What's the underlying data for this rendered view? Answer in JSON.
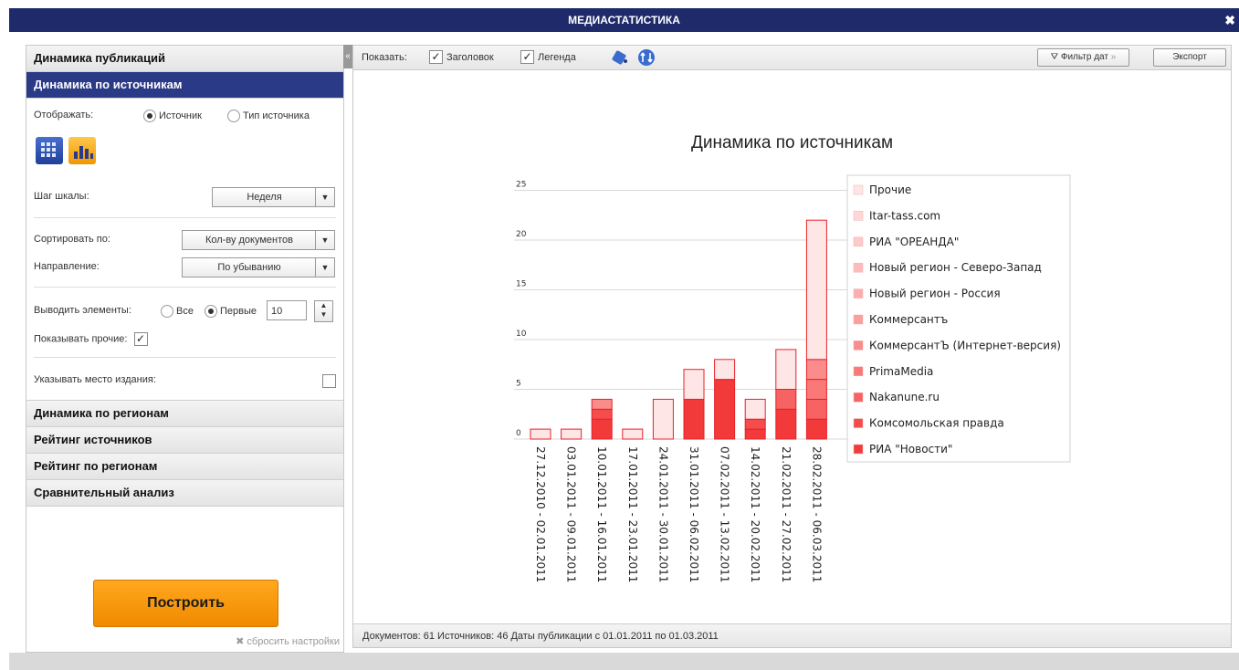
{
  "window": {
    "title": "МЕДИАСТАТИСТИКА",
    "close_glyph": "✖"
  },
  "left": {
    "section_publications": "Динамика публикаций",
    "section_sources": "Динамика по источникам",
    "display_label": "Отображать:",
    "radio_source": "Источник",
    "radio_source_type": "Тип источника",
    "scale_step_label": "Шаг шкалы:",
    "scale_step_value": "Неделя",
    "sort_label": "Сортировать по:",
    "sort_value": "Кол-ву документов",
    "direction_label": "Направление:",
    "direction_value": "По убыванию",
    "output_label": "Выводить элементы:",
    "radio_all": "Все",
    "radio_first": "Первые",
    "first_count": "10",
    "show_other_label": "Показывать прочие:",
    "place_label": "Указывать место издания:",
    "section_regions": "Динамика по регионам",
    "section_rating_sources": "Рейтинг источников",
    "section_rating_regions": "Рейтинг по регионам",
    "section_compare": "Сравнительный анализ",
    "build_button": "Построить",
    "reset_link": "сбросить настройки"
  },
  "toolbar": {
    "show_label": "Показать:",
    "header_check": "Заголовок",
    "legend_check": "Легенда",
    "date_filter": "Фильтр дат",
    "export": "Экспорт"
  },
  "status": {
    "text": "Документов: 61  Источников: 46  Даты публикации с 01.01.2011 по 01.03.2011"
  },
  "chart_data": {
    "type": "bar",
    "stacked": true,
    "title": "Динамика по источникам",
    "ylim": [
      0,
      25
    ],
    "yticks": [
      "0",
      "5",
      "10",
      "15",
      "20",
      "25"
    ],
    "categories": [
      "27.12.2010 - 02.01.2011",
      "03.01.2011 - 09.01.2011",
      "10.01.2011 - 16.01.2011",
      "17.01.2011 - 23.01.2011",
      "24.01.2011 - 30.01.2011",
      "31.01.2011 - 06.02.2011",
      "07.02.2011 - 13.02.2011",
      "14.02.2011 - 20.02.2011",
      "21.02.2011 - 27.02.2011",
      "28.02.2011 - 06.03.2011"
    ],
    "series": [
      {
        "name": "РИА \"Новости\"",
        "color": "#f23a3a",
        "values": [
          0,
          0,
          2,
          0,
          0,
          4,
          6,
          1,
          3,
          2
        ]
      },
      {
        "name": "Комсомольская правда",
        "color": "#f54c4c",
        "values": [
          0,
          0,
          1,
          0,
          0,
          0,
          0,
          1,
          0,
          0
        ]
      },
      {
        "name": "Nakanune.ru",
        "color": "#f76262",
        "values": [
          0,
          0,
          0,
          0,
          0,
          0,
          0,
          0,
          2,
          2
        ]
      },
      {
        "name": "PrimaMedia",
        "color": "#f97878",
        "values": [
          0,
          0,
          0,
          0,
          0,
          0,
          0,
          0,
          0,
          2
        ]
      },
      {
        "name": "КоммерсантЪ (Интернет-версия)",
        "color": "#fa8c8c",
        "values": [
          0,
          0,
          1,
          0,
          0,
          0,
          0,
          0,
          0,
          2
        ]
      },
      {
        "name": "Коммерсантъ",
        "color": "#fb9e9e",
        "values": [
          0,
          0,
          0,
          0,
          0,
          0,
          0,
          0,
          0,
          0
        ]
      },
      {
        "name": "Новый регион - Россия",
        "color": "#fcaeae",
        "values": [
          0,
          0,
          0,
          0,
          0,
          0,
          0,
          0,
          0,
          0
        ]
      },
      {
        "name": "Новый регион - Северо-Запад",
        "color": "#fdbcbc",
        "values": [
          0,
          0,
          0,
          0,
          0,
          0,
          0,
          0,
          0,
          0
        ]
      },
      {
        "name": "РИА \"ОРЕАНДА\"",
        "color": "#fdcaca",
        "values": [
          0,
          0,
          0,
          0,
          0,
          0,
          0,
          0,
          0,
          0
        ]
      },
      {
        "name": "Itar-tass.com",
        "color": "#fed8d8",
        "values": [
          0,
          0,
          0,
          0,
          0,
          0,
          0,
          0,
          0,
          0
        ]
      },
      {
        "name": "Прочие",
        "color": "#fee6e6",
        "values": [
          1,
          1,
          0,
          1,
          4,
          3,
          2,
          2,
          4,
          14
        ]
      }
    ],
    "legend_position": "right",
    "grid": true
  }
}
